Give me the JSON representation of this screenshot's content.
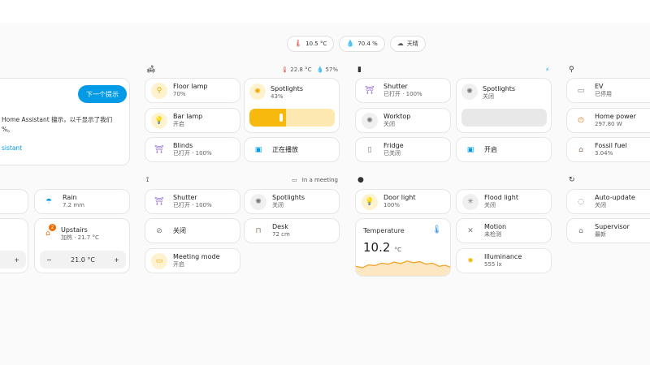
{
  "status_chips": [
    {
      "icon": "thermometer-icon",
      "glyph": "🌡",
      "text": "10.5 °C",
      "color": "#db4437"
    },
    {
      "icon": "water-drop-icon",
      "glyph": "💧",
      "text": "70.4 %",
      "color": "#1e88e5"
    },
    {
      "icon": "weather-icon",
      "glyph": "☁",
      "text": "天晴",
      "color": "#555555"
    }
  ],
  "left": {
    "assistant_card": {
      "button_label": "下一个提示",
      "text": "Home Assistant 擅示，以千显示了我们",
      "text2": "%。",
      "link": "sistant"
    },
    "rain": {
      "name": "Rain",
      "state": "7.2 mm"
    },
    "upstairs": {
      "name": "Upstairs",
      "state": "加热 · 21.7 °C",
      "badge": "2",
      "setpoint": "21.0 °C"
    },
    "left_stepper": {
      "plus": "+"
    },
    "minus": "−",
    "plus": "+"
  },
  "living": {
    "icon_glyph": "🛋",
    "temp": "22.8 °C",
    "humidity": "57%",
    "floor_lamp": {
      "name": "Floor lamp",
      "state": "70%"
    },
    "spotlights": {
      "name": "Spotlights",
      "state": "43%",
      "level": 0.43
    },
    "bar_lamp": {
      "name": "Bar lamp",
      "state": "开启"
    },
    "blinds": {
      "name": "Blinds",
      "state": "已打开 · 100%"
    },
    "tv": {
      "state": "正在播放"
    }
  },
  "office": {
    "status": "In a meeting",
    "shutter": {
      "name": "Shutter",
      "state": "已打开 · 100%"
    },
    "spotlights": {
      "name": "Spotlights",
      "state": "关闭"
    },
    "plug": {
      "state": "关闭"
    },
    "desk": {
      "name": "Desk",
      "state": "72 cm"
    },
    "meeting_mode": {
      "name": "Meeting mode",
      "state": "开启"
    }
  },
  "kitchen": {
    "shutter": {
      "name": "Shutter",
      "state": "已打开 · 100%"
    },
    "spotlights": {
      "name": "Spotlights",
      "state": "关闭"
    },
    "worktop": {
      "name": "Worktop",
      "state": "关闭"
    },
    "fridge": {
      "name": "Fridge",
      "state": "已关闭"
    },
    "appliance": {
      "state": "开启"
    }
  },
  "entrance": {
    "door_light": {
      "name": "Door light",
      "state": "100%"
    },
    "flood_light": {
      "name": "Flood light",
      "state": "关闭"
    },
    "temperature": {
      "label": "Temperature",
      "value": "10.2",
      "unit": "°C",
      "trend": [
        0.55,
        0.62,
        0.48,
        0.52,
        0.4,
        0.45,
        0.35,
        0.42,
        0.3,
        0.38,
        0.33,
        0.45,
        0.4,
        0.55,
        0.5,
        0.62
      ]
    },
    "motion": {
      "name": "Motion",
      "state": "未检测"
    },
    "illuminance": {
      "name": "Illuminance",
      "state": "555 lx"
    }
  },
  "energy": {
    "ev": {
      "name": "EV",
      "state": "已停用"
    },
    "home_power": {
      "name": "Home power",
      "state": "297.80 W"
    },
    "fossil_fuel": {
      "name": "Fossil fuel",
      "state": "3.04%"
    }
  },
  "system": {
    "auto_update": {
      "name": "Auto-update",
      "state": "关闭"
    },
    "supervisor": {
      "name": "Supervisor",
      "state": "最新"
    }
  }
}
